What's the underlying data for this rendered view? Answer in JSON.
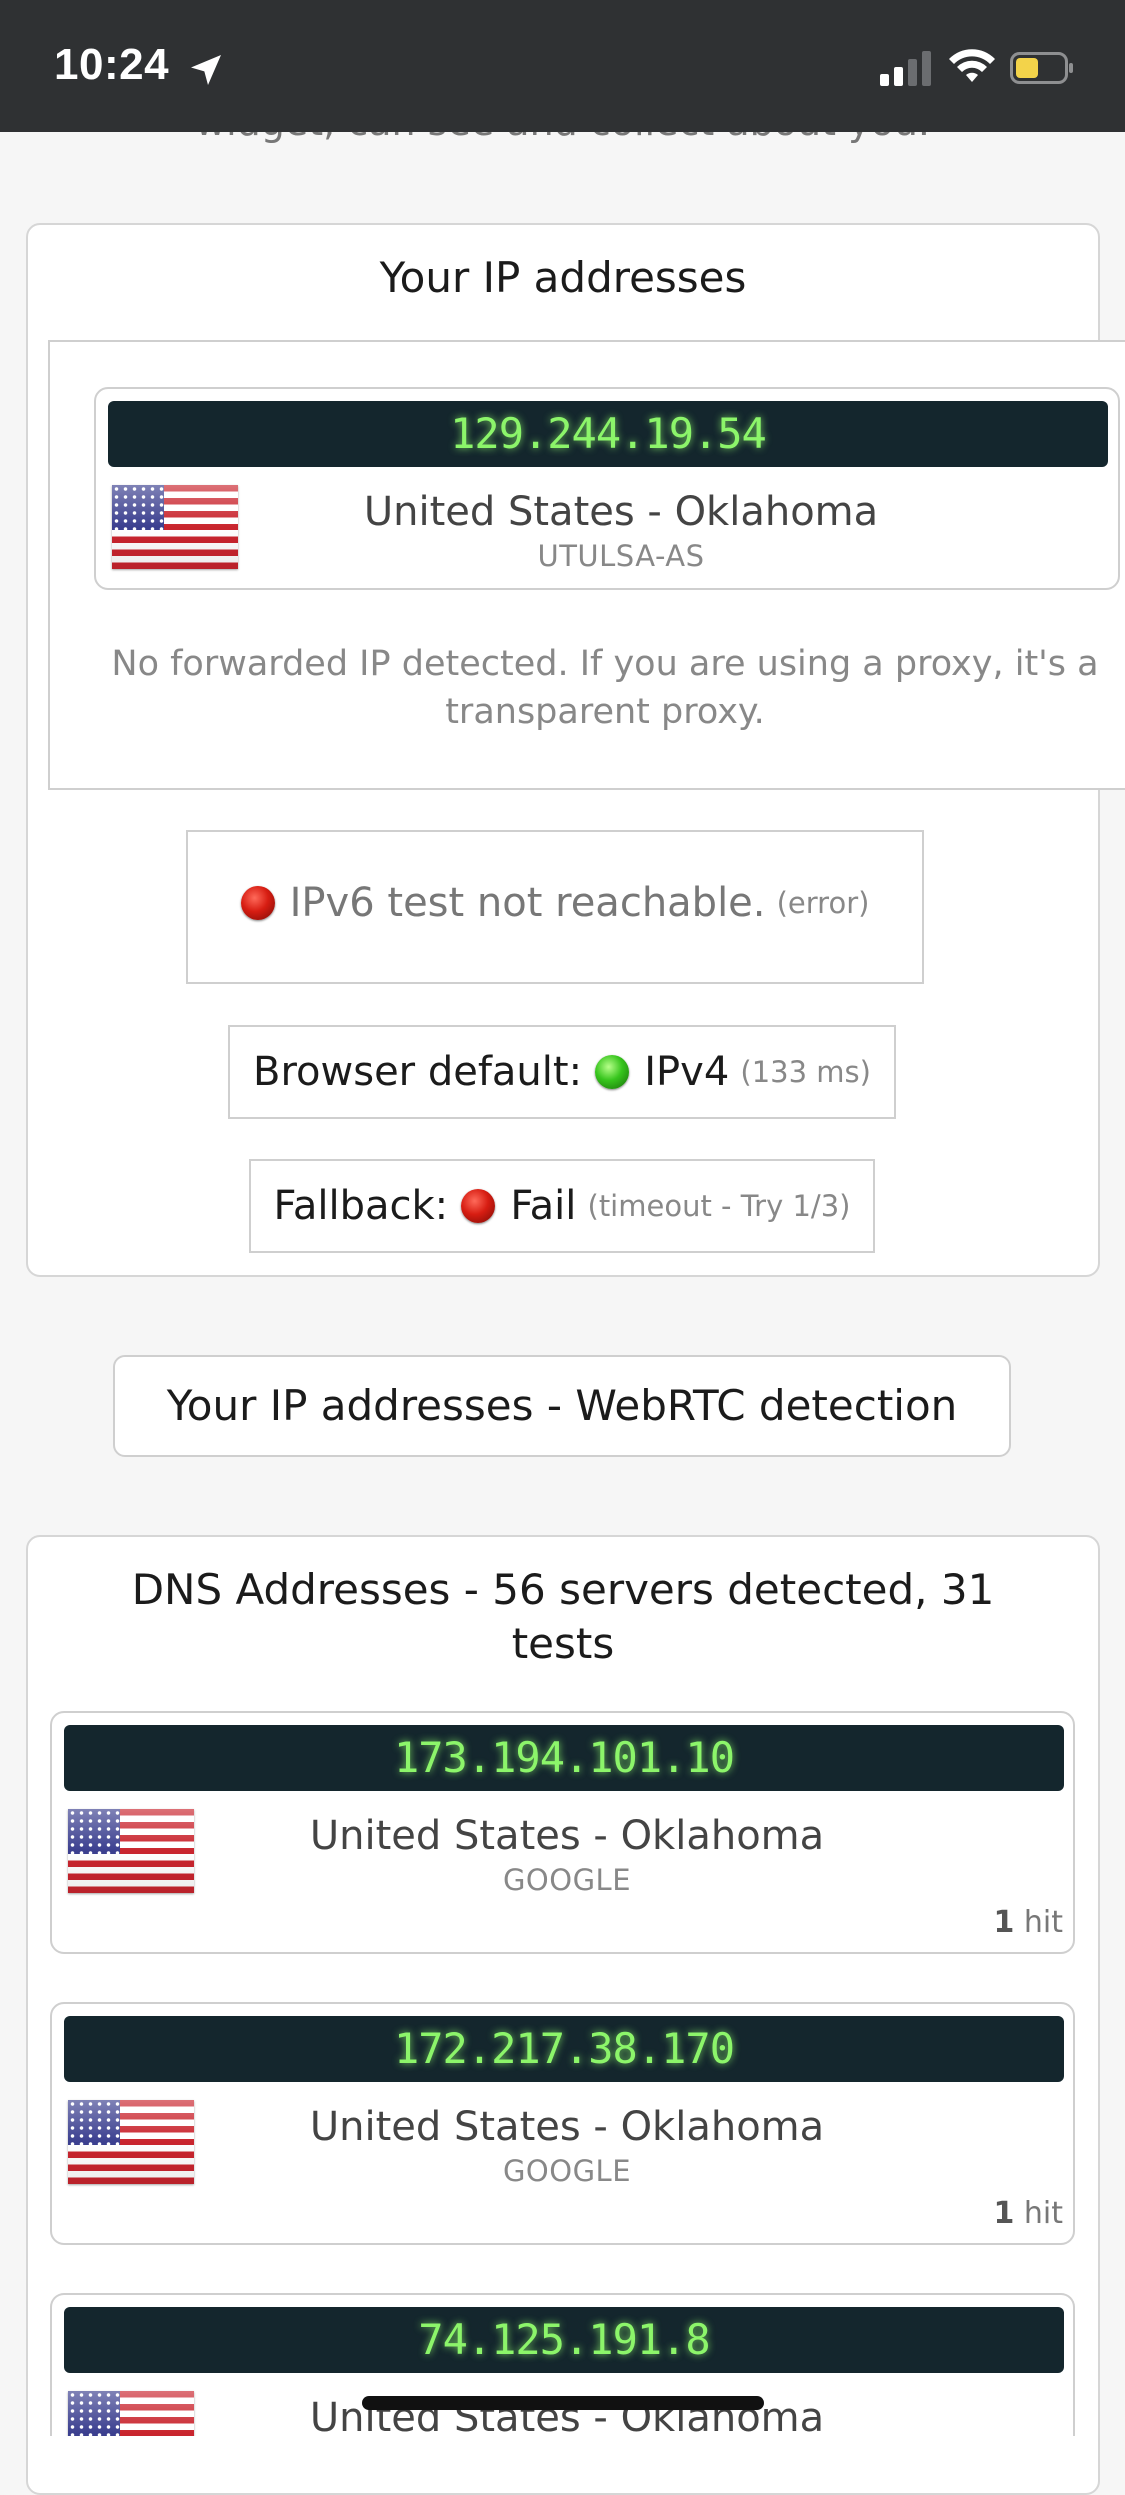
{
  "status_bar": {
    "time": "10:24",
    "icons": [
      "location-arrow-icon",
      "cellular-signal-icon",
      "wifi-icon",
      "battery-icon"
    ]
  },
  "intro": {
    "partial_text": "widget, can see and collect about you."
  },
  "ip_card": {
    "title": "Your IP addresses",
    "primary_ip": {
      "ip": "129.244.19.54",
      "location": "United States - Oklahoma",
      "isp": "UTULSA-AS"
    },
    "forwarded_note": "No forwarded IP detected. If you are using a proxy, it's a transparent proxy.",
    "ipv6": {
      "text": "IPv6 test not reachable.",
      "note": "(error)"
    },
    "browser_default": {
      "label": "Browser default:",
      "value": "IPv4",
      "note": "(133 ms)"
    },
    "fallback": {
      "label": "Fallback:",
      "value": "Fail",
      "note": "(timeout - Try 1/3)"
    }
  },
  "webrtc_button": {
    "label": "Your IP addresses - WebRTC detection"
  },
  "dns_card": {
    "title": "DNS Addresses - 56 servers detected, 31 tests",
    "entries": [
      {
        "ip": "173.194.101.10",
        "location": "United States - Oklahoma",
        "isp": "GOOGLE",
        "hits": "1",
        "hit_label": "hit"
      },
      {
        "ip": "172.217.38.170",
        "location": "United States - Oklahoma",
        "isp": "GOOGLE",
        "hits": "1",
        "hit_label": "hit"
      },
      {
        "ip": "74.125.191.8",
        "location": "United States - Oklahoma"
      }
    ]
  },
  "colors": {
    "ip_bar_bg": "#14262d",
    "ip_text": "#8cf56a",
    "status_bar_bg": "#2f3133",
    "status_red": "#d71d12",
    "status_green": "#37c51d"
  }
}
